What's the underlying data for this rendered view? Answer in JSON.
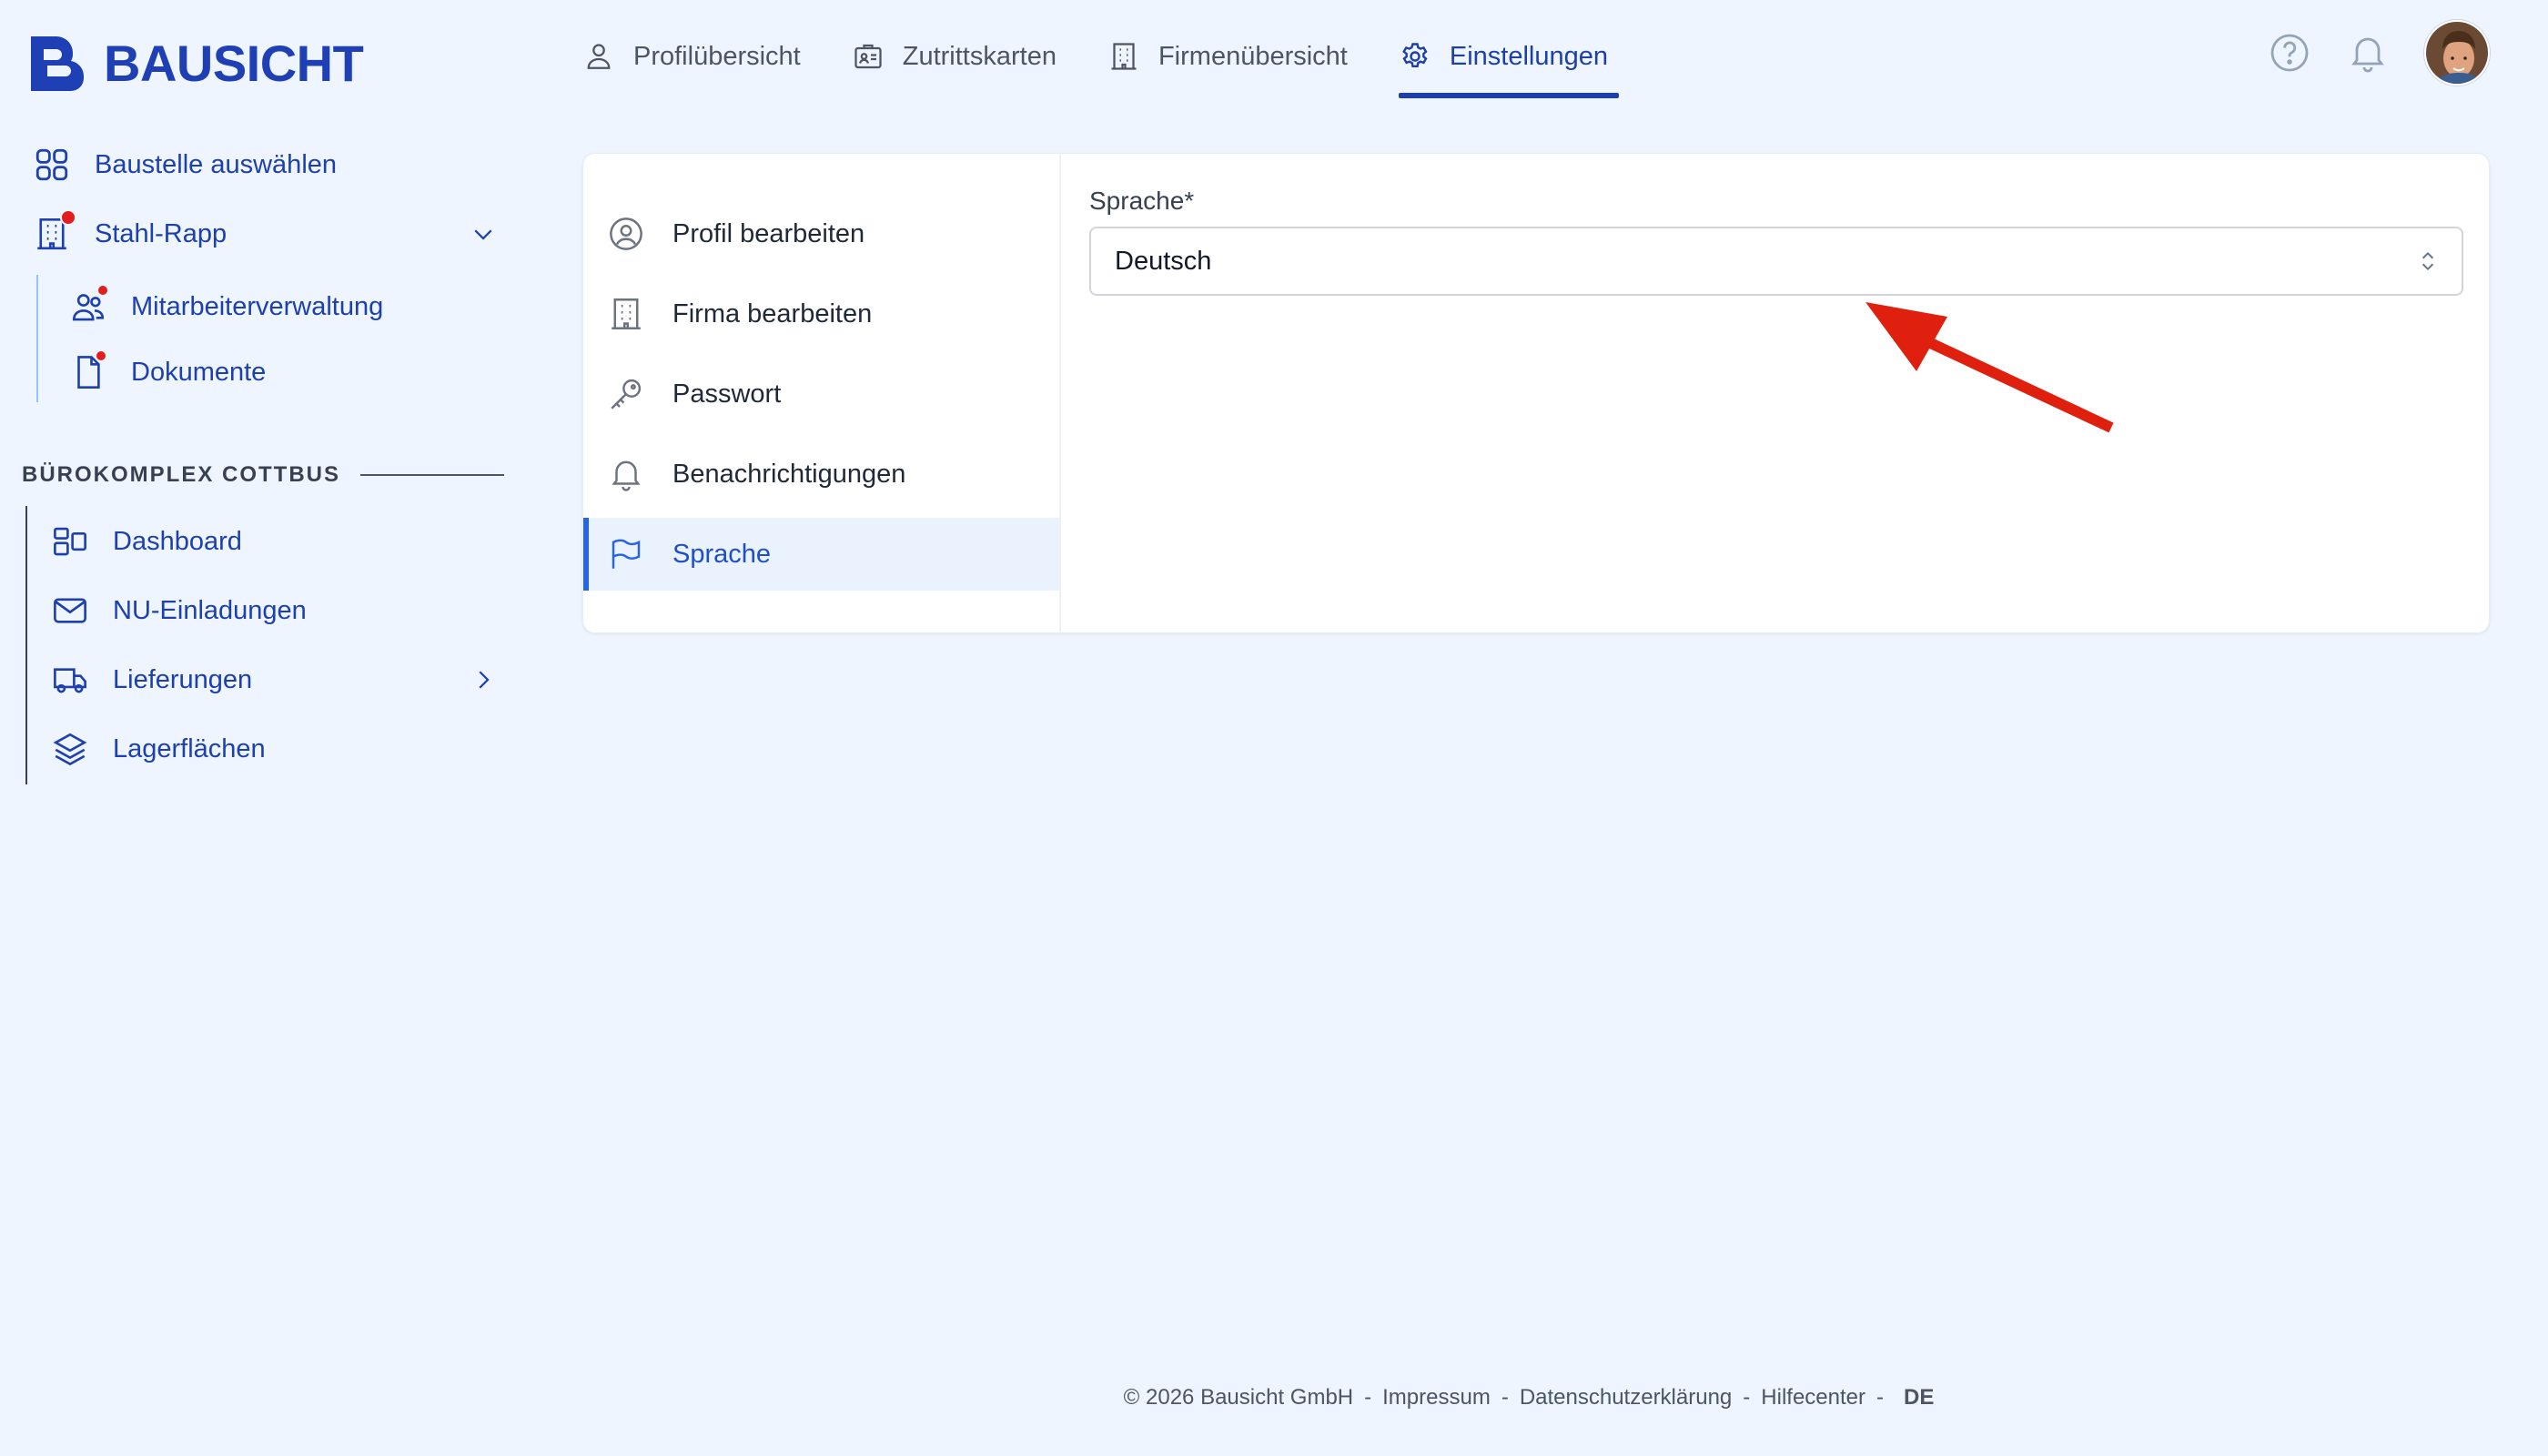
{
  "brand": {
    "name": "BAUSICHT"
  },
  "topnav": {
    "tabs": [
      {
        "label": "Profilübersicht",
        "icon": "user-icon"
      },
      {
        "label": "Zutrittskarten",
        "icon": "id-card-icon"
      },
      {
        "label": "Firmenübersicht",
        "icon": "building-icon"
      },
      {
        "label": "Einstellungen",
        "icon": "gear-icon",
        "active": true
      }
    ]
  },
  "header": {
    "help_icon": "help-icon",
    "bell_icon": "bell-icon"
  },
  "sidebar": {
    "select_site": "Baustelle auswählen",
    "company": "Stahl-Rapp",
    "company_children": [
      "Mitarbeiterverwaltung",
      "Dokumente"
    ],
    "section_title": "BÜROKOMPLEX COTTBUS",
    "section_items": [
      "Dashboard",
      "NU-Einladungen",
      "Lieferungen",
      "Lagerflächen"
    ]
  },
  "settings_menu": {
    "items": [
      {
        "label": "Profil bearbeiten",
        "icon": "user-circle-icon"
      },
      {
        "label": "Firma bearbeiten",
        "icon": "building-icon"
      },
      {
        "label": "Passwort",
        "icon": "key-icon"
      },
      {
        "label": "Benachrichtigungen",
        "icon": "bell-icon"
      },
      {
        "label": "Sprache",
        "icon": "flag-icon",
        "active": true
      }
    ]
  },
  "language_form": {
    "label": "Sprache*",
    "selected": "Deutsch"
  },
  "footer": {
    "copyright": "© 2026 Bausicht GmbH",
    "sep": "-",
    "links": [
      "Impressum",
      "Datenschutzerklärung",
      "Hilfecenter"
    ],
    "lang": "DE"
  },
  "colors": {
    "brand": "#1f3fb4",
    "active": "#2563eb",
    "notification": "#e11d1d",
    "annotation_arrow": "#e0200f",
    "background": "#eef5fe"
  }
}
